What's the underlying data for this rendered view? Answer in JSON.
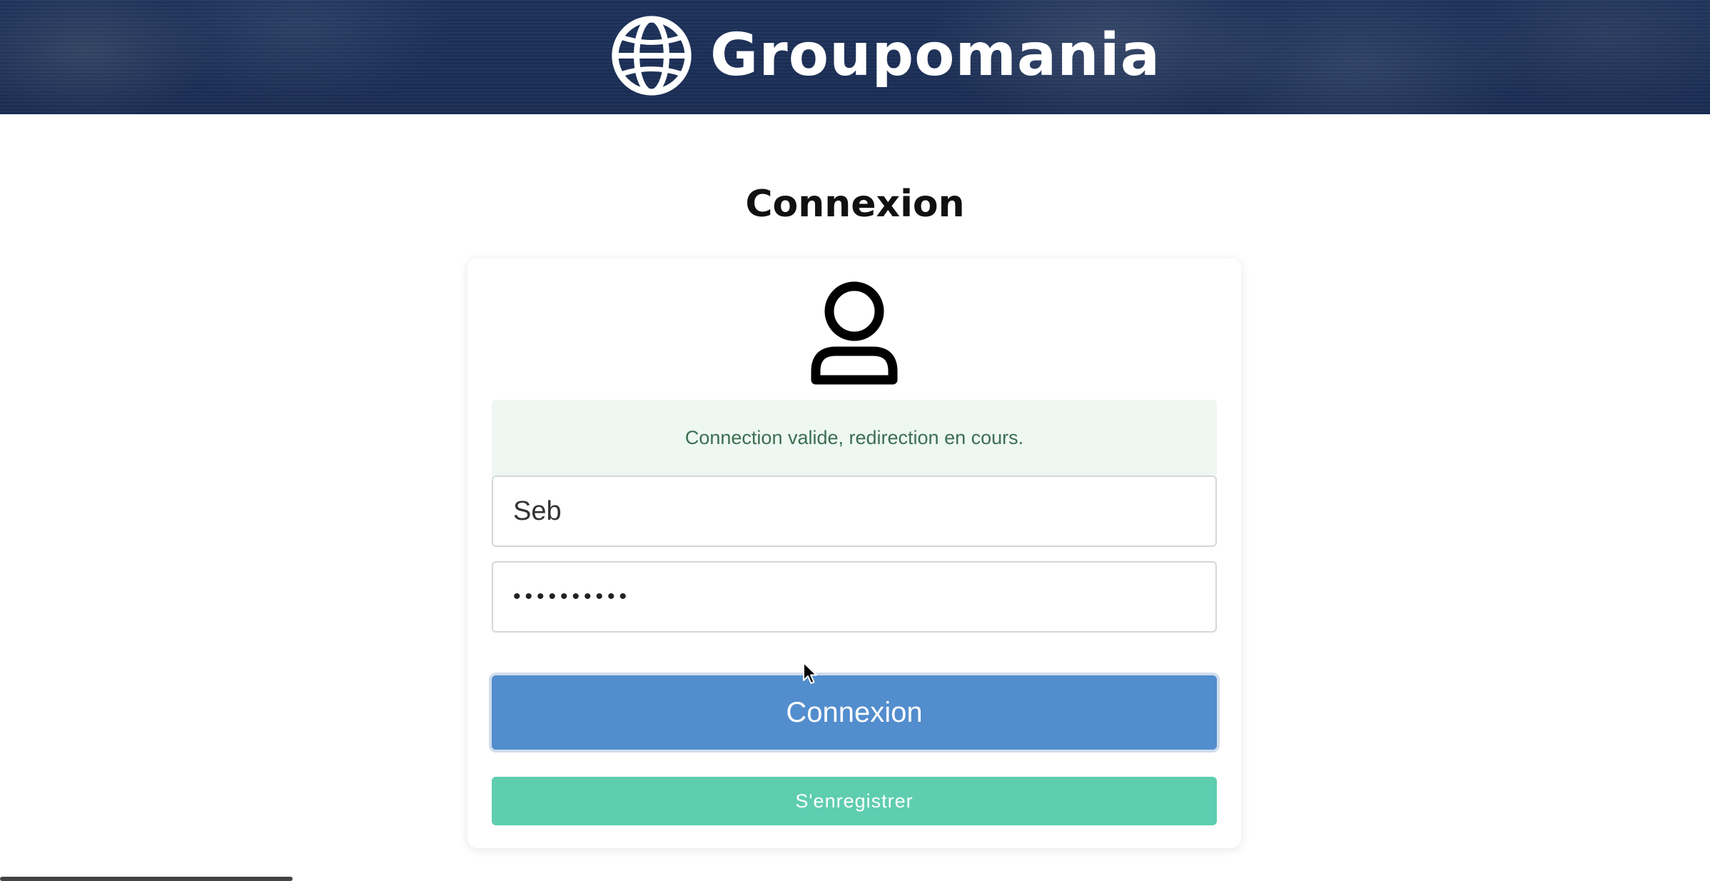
{
  "header": {
    "brand_name": "Groupomania",
    "logo_icon": "globe-icon",
    "background_color": "#1b2e55"
  },
  "page": {
    "title": "Connexion"
  },
  "form": {
    "avatar_icon": "user-icon",
    "alert_message": "Connection valide, redirection en cours.",
    "alert_color": "#3c6e53",
    "username_value": "Seb",
    "password_value": "••••••••••",
    "login_button_label": "Connexion",
    "login_button_color": "#528dcd",
    "register_button_label": "S'enregistrer",
    "register_button_color": "#5ecdb0"
  }
}
